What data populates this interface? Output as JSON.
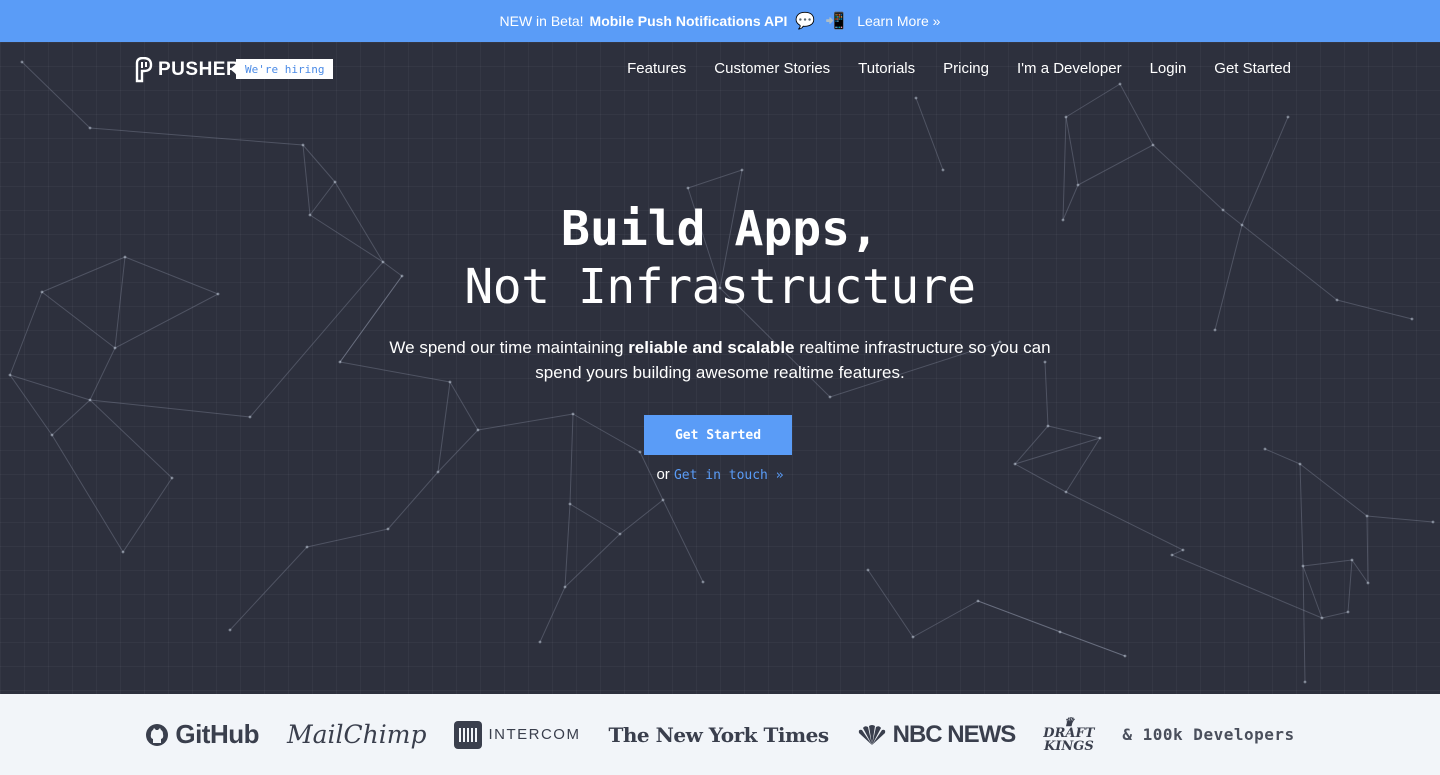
{
  "banner": {
    "prefix": "NEW in Beta!",
    "title": "Mobile Push Notifications API",
    "icon_chat": "💬",
    "icon_phone": "📲",
    "link": "Learn More »"
  },
  "nav": {
    "logo_text": "PUSHER",
    "hiring_label": "We're hiring",
    "links": [
      "Features",
      "Customer Stories",
      "Tutorials",
      "Pricing",
      "I'm a Developer",
      "Login",
      "Get Started"
    ]
  },
  "hero": {
    "headline_line1": "Build Apps,",
    "headline_line2": "Not Infrastructure",
    "tagline_pre": "We spend our time maintaining ",
    "tagline_bold": "reliable and scalable",
    "tagline_post": " realtime infrastructure so you can spend yours building awesome realtime features.",
    "cta_label": "Get Started",
    "contact_prefix": "or",
    "contact_link": "Get in touch »"
  },
  "logos": {
    "github": "GitHub",
    "mailchimp": "MailChimp",
    "intercom": "INTERCOM",
    "nyt": "The New York Times",
    "nbc": "NBC NEWS",
    "draftkings_1": "DRAFT",
    "draftkings_2": "KINGS",
    "developers": "& 100k Developers"
  },
  "colors": {
    "accent": "#5a9cf7",
    "hero_bg": "#2d303d",
    "strip_bg": "#f2f5f9"
  }
}
